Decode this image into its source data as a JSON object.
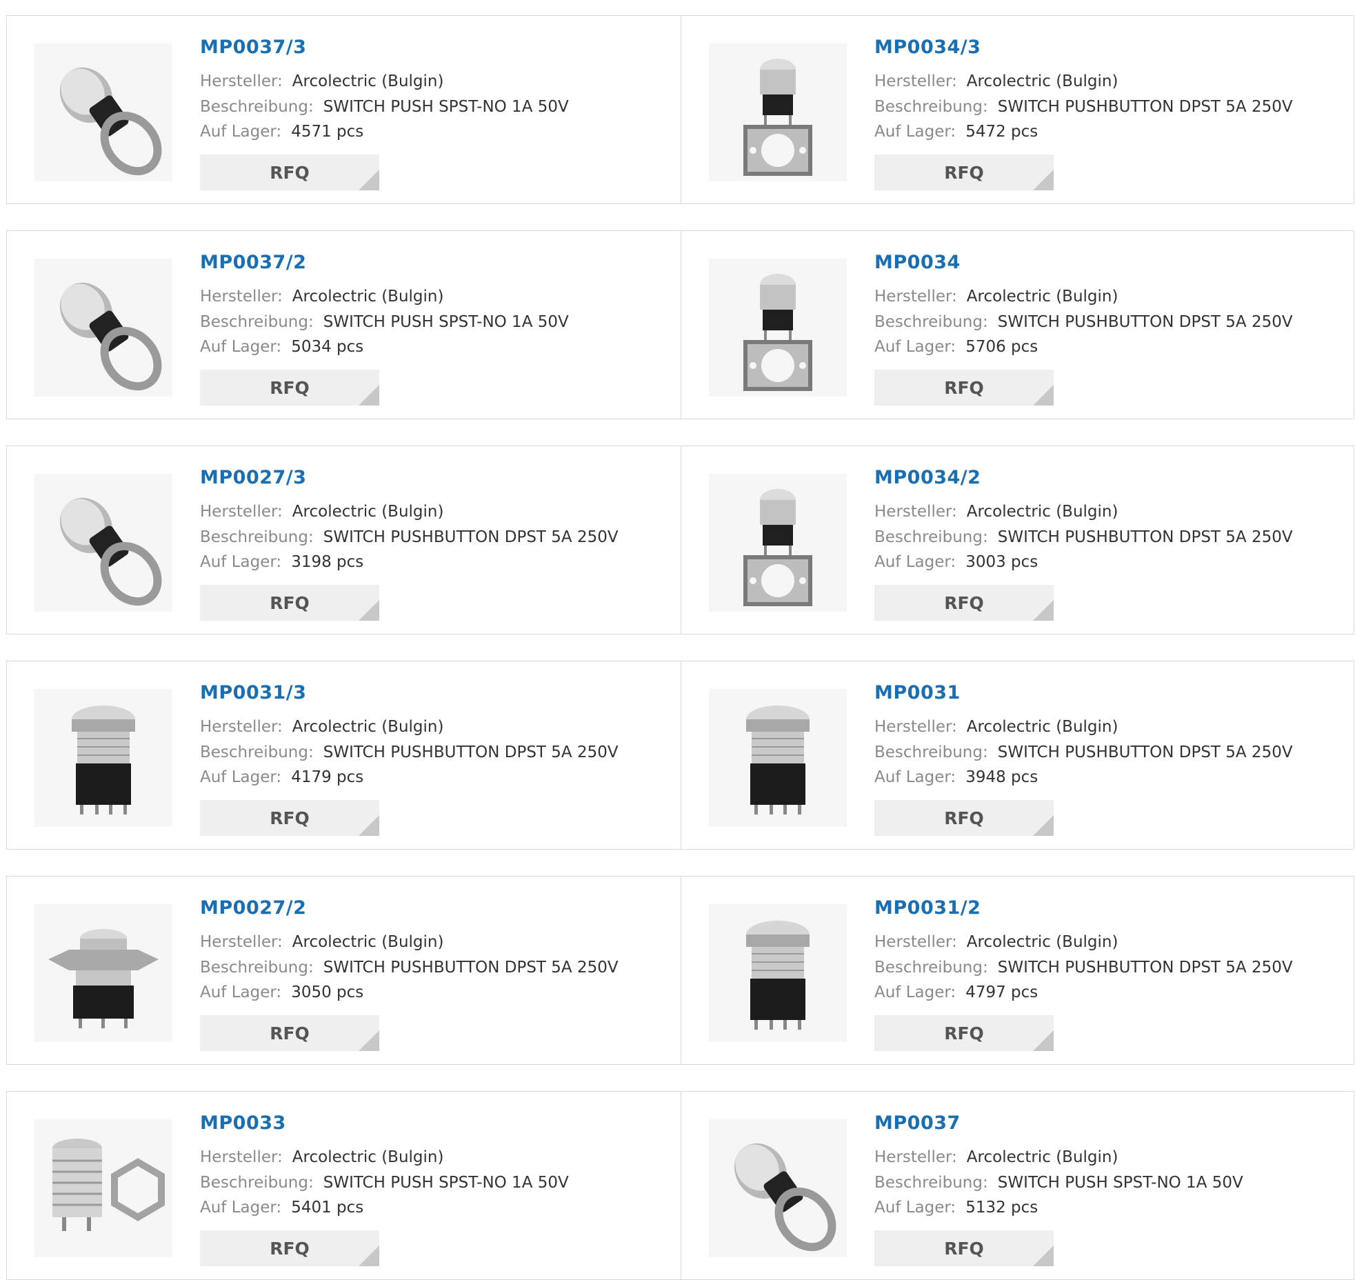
{
  "labels": {
    "manufacturer": "Hersteller:",
    "description": "Beschreibung:",
    "stock": "Auf Lager:",
    "rfq": "RFQ"
  },
  "products": [
    {
      "part": "MP0037/3",
      "manufacturer": "Arcolectric (Bulgin)",
      "description": "SWITCH PUSH SPST-NO 1A 50V",
      "stock": "4571 pcs",
      "icon": "round-switch-with-nut"
    },
    {
      "part": "MP0034/3",
      "manufacturer": "Arcolectric (Bulgin)",
      "description": "SWITCH PUSHBUTTON DPST 5A 250V",
      "stock": "5472 pcs",
      "icon": "switch-with-plate"
    },
    {
      "part": "MP0037/2",
      "manufacturer": "Arcolectric (Bulgin)",
      "description": "SWITCH PUSH SPST-NO 1A 50V",
      "stock": "5034 pcs",
      "icon": "round-switch-with-nut"
    },
    {
      "part": "MP0034",
      "manufacturer": "Arcolectric (Bulgin)",
      "description": "SWITCH PUSHBUTTON DPST 5A 250V",
      "stock": "5706 pcs",
      "icon": "switch-with-plate"
    },
    {
      "part": "MP0027/3",
      "manufacturer": "Arcolectric (Bulgin)",
      "description": "SWITCH PUSHBUTTON DPST 5A 250V",
      "stock": "3198 pcs",
      "icon": "round-switch-with-nut"
    },
    {
      "part": "MP0034/2",
      "manufacturer": "Arcolectric (Bulgin)",
      "description": "SWITCH PUSHBUTTON DPST 5A 250V",
      "stock": "3003 pcs",
      "icon": "switch-with-plate"
    },
    {
      "part": "MP0031/3",
      "manufacturer": "Arcolectric (Bulgin)",
      "description": "SWITCH PUSHBUTTON DPST 5A 250V",
      "stock": "4179 pcs",
      "icon": "tall-pushbutton-switch"
    },
    {
      "part": "MP0031",
      "manufacturer": "Arcolectric (Bulgin)",
      "description": "SWITCH PUSHBUTTON DPST 5A 250V",
      "stock": "3948 pcs",
      "icon": "tall-pushbutton-switch"
    },
    {
      "part": "MP0027/2",
      "manufacturer": "Arcolectric (Bulgin)",
      "description": "SWITCH PUSHBUTTON DPST 5A 250V",
      "stock": "3050 pcs",
      "icon": "flanged-pushbutton-switch"
    },
    {
      "part": "MP0031/2",
      "manufacturer": "Arcolectric (Bulgin)",
      "description": "SWITCH PUSHBUTTON DPST 5A 250V",
      "stock": "4797 pcs",
      "icon": "tall-pushbutton-switch"
    },
    {
      "part": "MP0033",
      "manufacturer": "Arcolectric (Bulgin)",
      "description": "SWITCH PUSH SPST-NO 1A 50V",
      "stock": "5401 pcs",
      "icon": "threaded-switch-with-nut"
    },
    {
      "part": "MP0037",
      "manufacturer": "Arcolectric (Bulgin)",
      "description": "SWITCH PUSH SPST-NO 1A 50V",
      "stock": "5132 pcs",
      "icon": "round-switch-with-nut"
    }
  ],
  "colors": {
    "part_link": "#1a6fb3",
    "label_gray": "#8a8a8a",
    "value_dark": "#333333",
    "button_bg": "#efefef",
    "border": "#d9d9d9"
  }
}
